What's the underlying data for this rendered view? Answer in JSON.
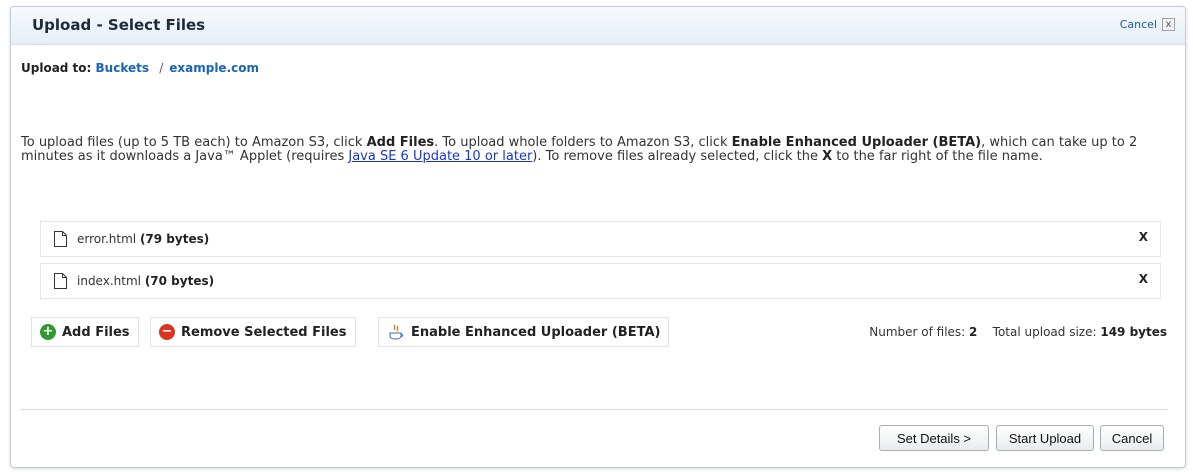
{
  "dialog": {
    "title": "Upload - Select Files",
    "cancel_label": "Cancel",
    "cancel_x": "x"
  },
  "upload_to": {
    "label": "Upload to:",
    "bucket": "Buckets",
    "separator": "/",
    "folder": "example.com"
  },
  "instructions": {
    "part1": "To upload files (up to 5 TB each) to Amazon S3, click ",
    "add_files": "Add Files",
    "part2": ". To upload whole folders to Amazon S3, click ",
    "enhanced": "Enable Enhanced Uploader (BETA)",
    "part3": ", which can take up to 2 minutes as it downloads a Java™ Applet (requires ",
    "java_link": "Java SE 6 Update 10 or later",
    "part4": "). To remove files already selected, click the ",
    "x": "X",
    "part5": " to the far right of the file name."
  },
  "files": [
    {
      "name": "error.html",
      "size": "(79 bytes)",
      "remove": "X"
    },
    {
      "name": "index.html",
      "size": "(70 bytes)",
      "remove": "X"
    }
  ],
  "actions": {
    "add_files": "Add Files",
    "remove_selected": "Remove Selected Files",
    "enhanced_uploader": "Enable Enhanced Uploader (BETA)"
  },
  "summary": {
    "num_files_label": "Number of files:",
    "num_files": "2",
    "total_label": "Total upload size:",
    "total_size": "149 bytes"
  },
  "footer": {
    "set_details": "Set Details >",
    "start_upload": "Start Upload",
    "cancel": "Cancel"
  },
  "colors": {
    "link": "#1a64b8",
    "java_link": "#1a35c9",
    "add_icon": "#2e9a2e",
    "remove_icon": "#d8341e"
  }
}
